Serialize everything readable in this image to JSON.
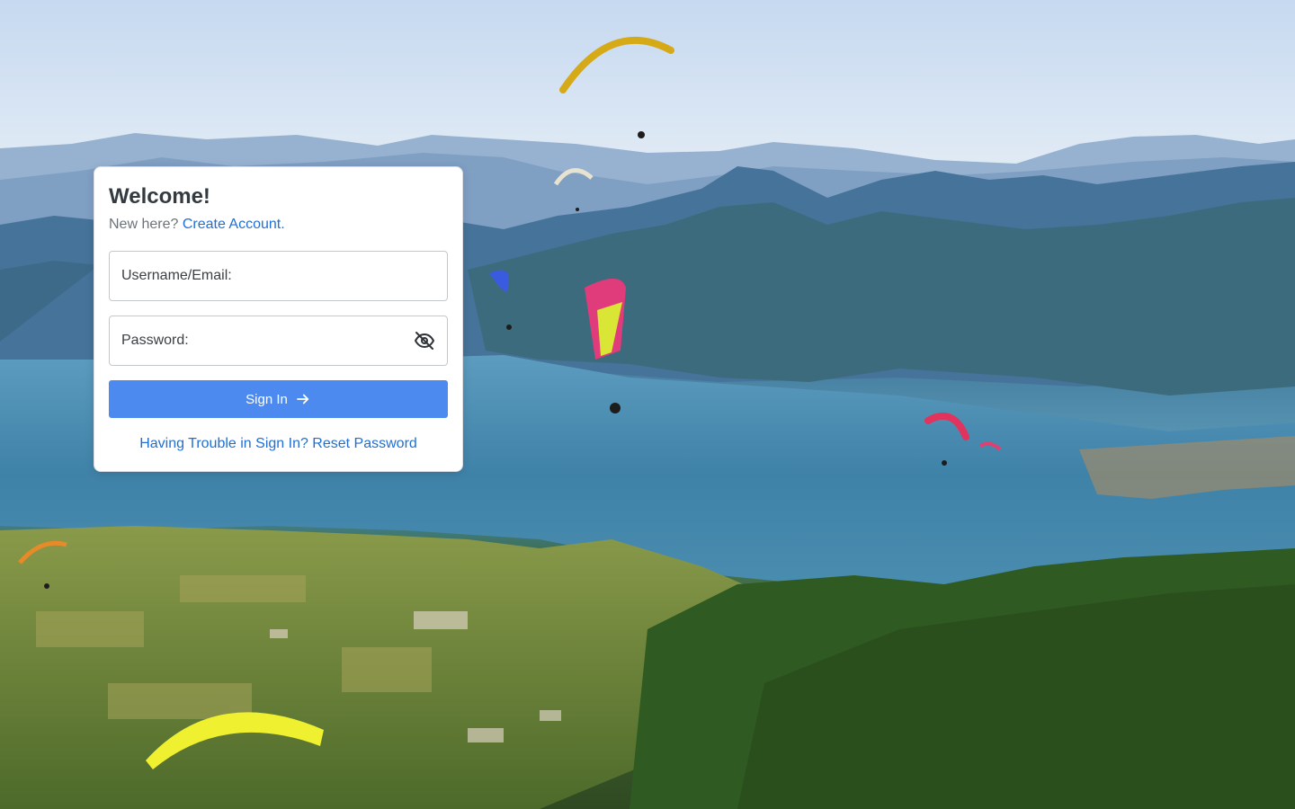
{
  "background": {
    "description_icon": "mountain-lake-paragliders-icon"
  },
  "login": {
    "title": "Welcome!",
    "new_here_text": "New here? ",
    "create_account_label": "Create Account.",
    "username_placeholder": "Username/Email:",
    "username_value": "",
    "password_placeholder": "Password:",
    "password_value": "",
    "visibility_icon": "eye-off-icon",
    "sign_in_label": "Sign In",
    "sign_in_icon": "arrow-right-icon",
    "trouble_text": "Having Trouble in Sign In? Reset Password"
  },
  "colors": {
    "primary_button": "#4d8af0",
    "link": "#1f6fd6",
    "title_text": "#333a40",
    "muted_text": "#6c737a"
  }
}
